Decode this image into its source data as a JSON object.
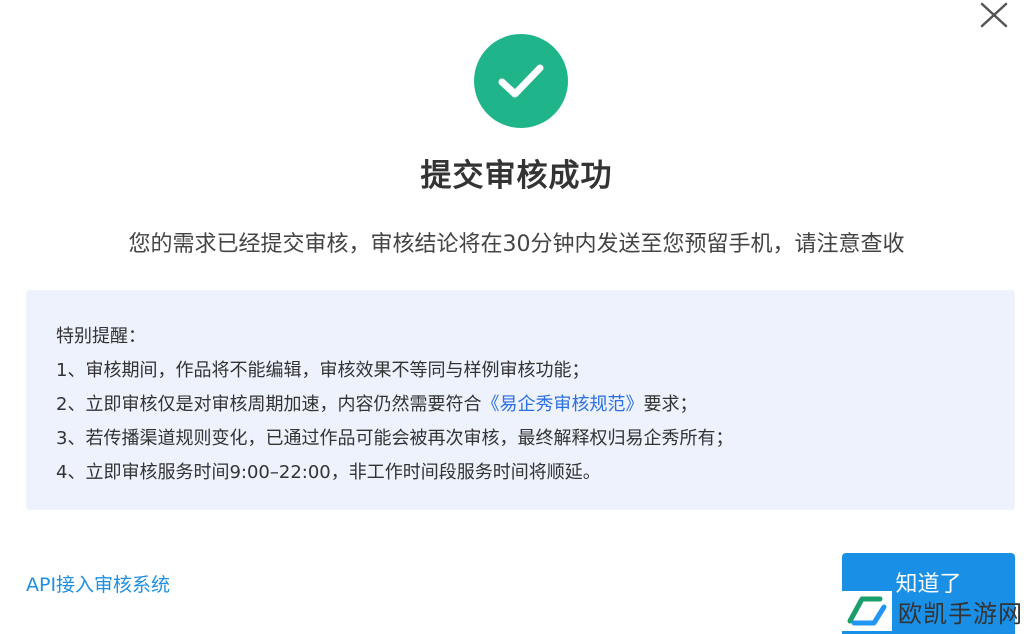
{
  "dialog": {
    "close_icon": "close-icon",
    "success_icon": "checkmark-circle-icon",
    "colors": {
      "success": "#1fb48a",
      "notice_bg": "#edf2fc",
      "link": "#2b6fe0",
      "primary_button": "#1a8fe6"
    },
    "title": "提交审核成功",
    "subtitle": "您的需求已经提交审核，审核结论将在30分钟内发送至您预留手机，请注意查收",
    "notice": {
      "heading": "特别提醒：",
      "item1": "1、审核期间，作品将不能编辑，审核效果不等同与样例审核功能；",
      "item2_prefix": "2、立即审核仅是对审核周期加速，内容仍然需要符合",
      "item2_link": "《易企秀审核规范》",
      "item2_suffix": "要求；",
      "item3": "3、若传播渠道规则变化，已通过作品可能会被再次审核，最终解释权归易企秀所有；",
      "item4": "4、立即审核服务时间9:00–22:00，非工作时间段服务时间将顺延。"
    },
    "api_link": "API接入审核系统",
    "confirm_button": "知道了"
  },
  "watermark": {
    "text": "欧凯手游网",
    "logo_icon": "watermark-logo-icon"
  }
}
